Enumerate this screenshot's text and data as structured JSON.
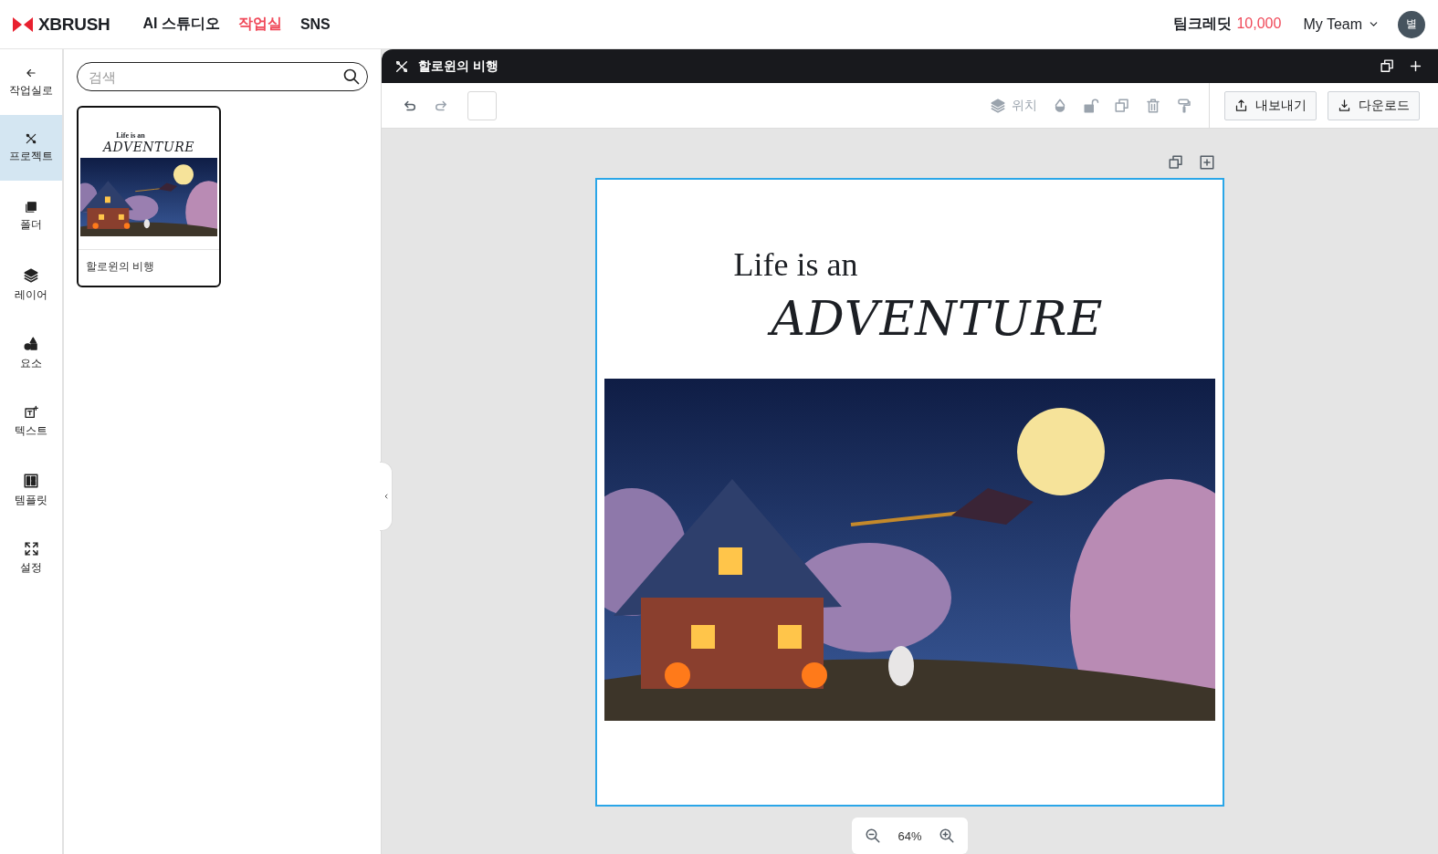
{
  "header": {
    "logo": "XBRUSH",
    "nav": [
      {
        "label": "AI 스튜디오",
        "selected": false
      },
      {
        "label": "작업실",
        "selected": true
      },
      {
        "label": "SNS",
        "selected": false
      }
    ],
    "credit_label": "팀크레딧",
    "credit_value": "10,000",
    "team": "My Team",
    "avatar": "별"
  },
  "rail": [
    {
      "label": "작업실로",
      "selected": false
    },
    {
      "label": "프로젝트",
      "selected": true
    },
    {
      "label": "폴더",
      "selected": false
    },
    {
      "label": "레이어",
      "selected": false
    },
    {
      "label": "요소",
      "selected": false
    },
    {
      "label": "텍스트",
      "selected": false
    },
    {
      "label": "템플릿",
      "selected": false
    },
    {
      "label": "설정",
      "selected": false
    }
  ],
  "panel": {
    "search": {
      "placeholder": "검색"
    },
    "projects": [
      {
        "title": "할로윈의 비행",
        "line1": "Life is an",
        "line2": "ADVENTURE"
      }
    ]
  },
  "editor": {
    "tab_title": "할로윈의 비행",
    "toolbar": {
      "undo": {
        "disabled": false
      },
      "redo": {
        "disabled": true
      },
      "position_label": "위치",
      "export": "내보내기",
      "download": "다운로드"
    },
    "canvas": {
      "line1": "Life is an",
      "line2": "ADVENTURE"
    },
    "zoom": "64%"
  }
}
